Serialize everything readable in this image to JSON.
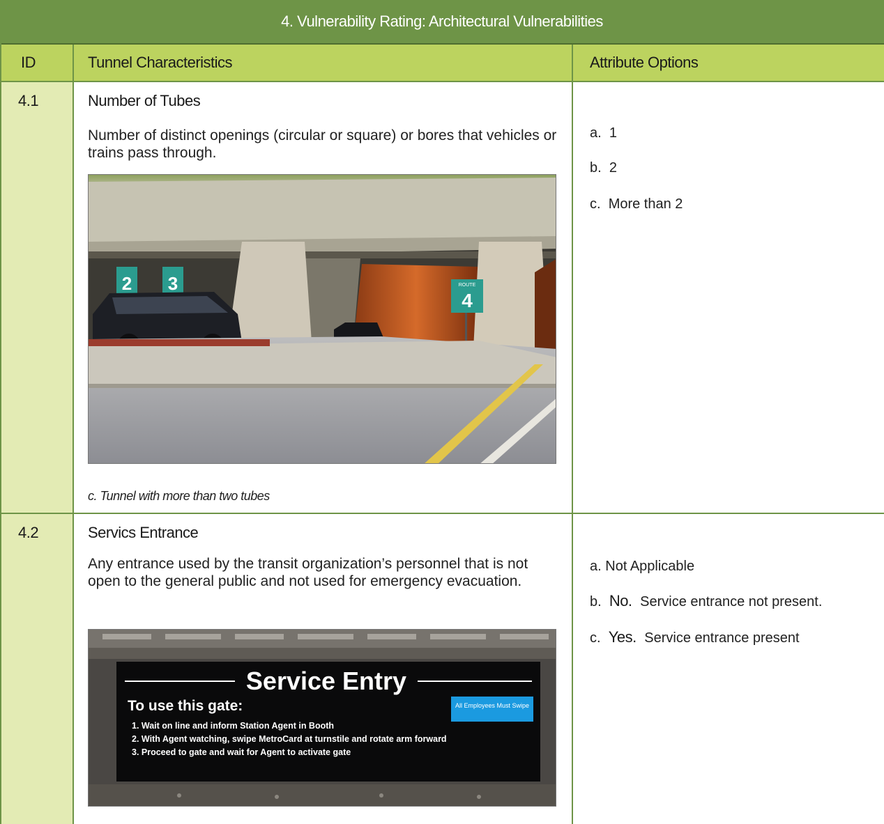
{
  "title": "4. Vulnerability Rating: Architectural Vulnerabilities",
  "headers": {
    "id": "ID",
    "characteristics": "Tunnel Characteristics",
    "options": "Attribute Options"
  },
  "rows": [
    {
      "id": "4.1",
      "title": "Number of Tubes",
      "description": "Number of distinct openings (circular or square) or bores that vehicles or trains pass through.",
      "caption": "c.  Tunnel with more than two tubes",
      "image": {
        "signs": [
          "2",
          "3",
          "4"
        ],
        "sign_word": "ROUTE"
      },
      "options": [
        {
          "prefix": "a.",
          "bold": "",
          "text": "1"
        },
        {
          "prefix": "b.",
          "bold": "",
          "text": "2"
        },
        {
          "prefix": "c.",
          "bold": "",
          "text": "More than 2"
        }
      ]
    },
    {
      "id": "4.2",
      "title": "Servics Entrance",
      "description": "Any entrance used by the transit organization’s personnel that is not open to the general public and not used for emergency evacuation.",
      "image": {
        "sign_title": "Service Entry",
        "sign_subtitle": "To use this gate:",
        "sign_badge": "All Employees Must Swipe",
        "sign_lines": [
          "1. Wait on line and inform Station Agent in Booth",
          "2. With Agent watching, swipe MetroCard at turnstile and rotate arm forward",
          "3. Proceed to gate and wait for Agent to activate gate"
        ]
      },
      "options": [
        {
          "prefix": "a.",
          "bold": "",
          "text": "Not Applicable"
        },
        {
          "prefix": "b.",
          "bold": "No.",
          "text": "Service entrance not present."
        },
        {
          "prefix": "c.",
          "bold": "Yes.",
          "text": "Service entrance present"
        }
      ]
    }
  ],
  "colors": {
    "title_bg": "#6e9447",
    "header_bg": "#bcd35f",
    "id_col_bg": "#e3ebb4",
    "rule": "#6e9447"
  }
}
